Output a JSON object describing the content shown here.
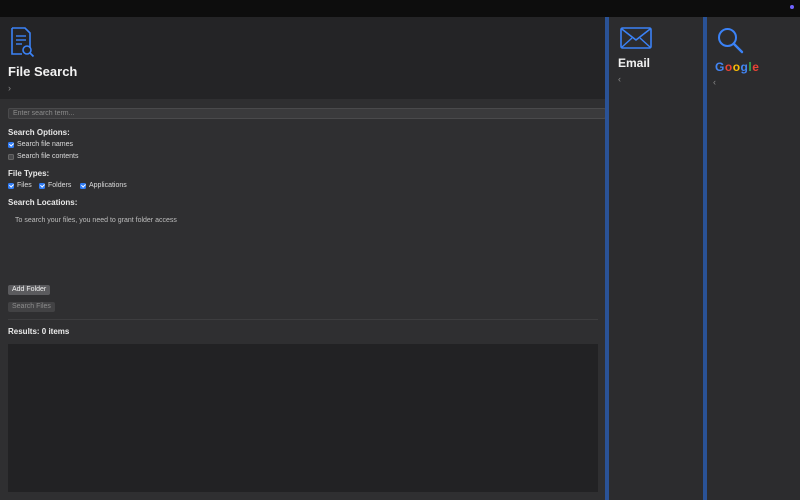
{
  "file_search": {
    "title": "File Search",
    "search_placeholder": "Enter search term...",
    "search_options_label": "Search Options:",
    "opt_file_names": "Search file names",
    "opt_file_contents": "Search file contents",
    "file_types_label": "File Types:",
    "type_files": "Files",
    "type_folders": "Folders",
    "type_applications": "Applications",
    "search_locations_label": "Search Locations:",
    "locations_message": "To search your files, you need to grant folder access",
    "add_folder_label": "Add Folder",
    "search_files_label": "Search Files",
    "results_label": "Results: 0 items",
    "checked": {
      "file_names": true,
      "file_contents": false,
      "files": true,
      "folders": true,
      "applications": true
    }
  },
  "email_panel": {
    "title": "Email",
    "icon": "envelope-icon"
  },
  "google_panel": {
    "letters": [
      "G",
      "o",
      "o",
      "g",
      "l",
      "e"
    ],
    "letter_colors": [
      "#4285F4",
      "#EA4335",
      "#FBBC05",
      "#4285F4",
      "#34A853",
      "#EA4335"
    ],
    "icon": "magnifier-icon"
  },
  "colors": {
    "accent": "#2f7cf6",
    "panel_bar": "#2a5296"
  }
}
